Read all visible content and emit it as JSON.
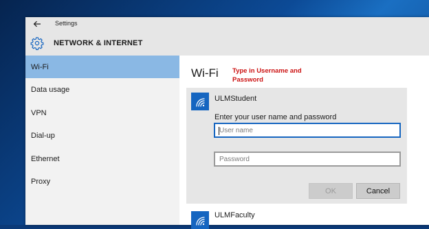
{
  "window": {
    "title": "Settings",
    "back_icon": "arrow-left-icon"
  },
  "header": {
    "icon": "gear-icon",
    "title": "NETWORK & INTERNET"
  },
  "sidebar": {
    "items": [
      {
        "label": "Wi-Fi",
        "active": true
      },
      {
        "label": "Data usage",
        "active": false
      },
      {
        "label": "VPN",
        "active": false
      },
      {
        "label": "Dial-up",
        "active": false
      },
      {
        "label": "Ethernet",
        "active": false
      },
      {
        "label": "Proxy",
        "active": false
      }
    ]
  },
  "main": {
    "title": "Wi-Fi",
    "annotation": "Type in Username and Password",
    "annotation_color": "#cc1111",
    "networks": [
      {
        "name": "ULMStudent",
        "icon": "wifi-icon",
        "prompt": "Enter your user name and password",
        "username_placeholder": "User name",
        "password_placeholder": "Password",
        "ok_label": "OK",
        "cancel_label": "Cancel"
      },
      {
        "name": "ULMFaculty",
        "icon": "wifi-icon"
      }
    ]
  },
  "colors": {
    "accent": "#1565c0",
    "selected_nav": "#8ab8e4"
  }
}
